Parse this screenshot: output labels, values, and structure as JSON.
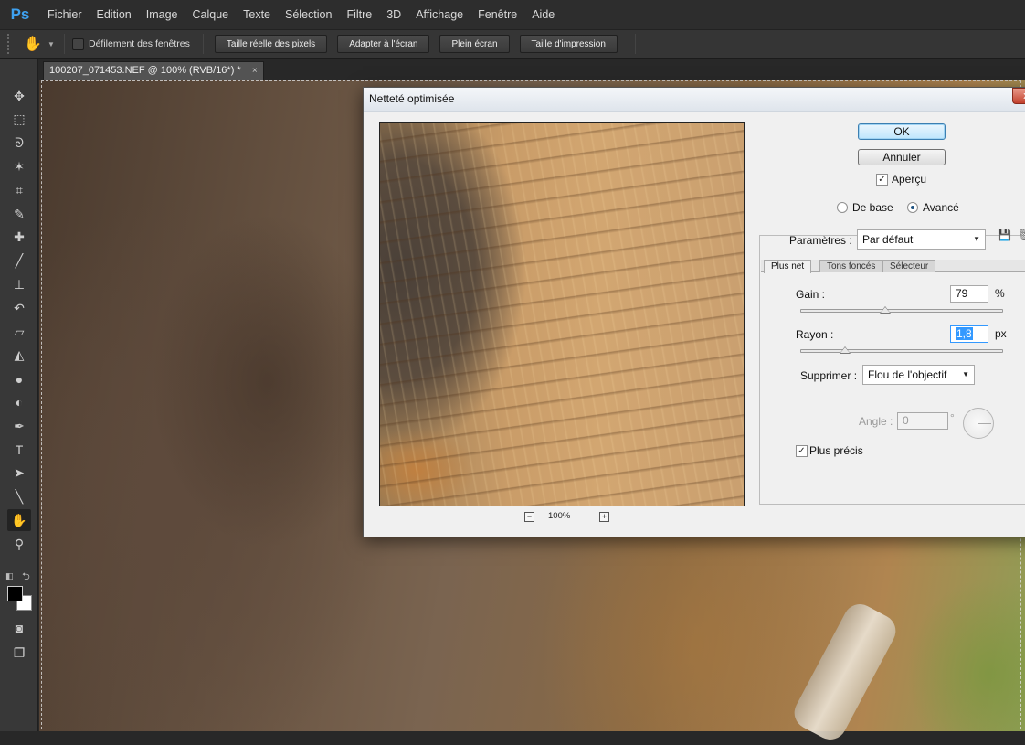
{
  "app": {
    "logo": "Ps",
    "menus": [
      "Fichier",
      "Edition",
      "Image",
      "Calque",
      "Texte",
      "Sélection",
      "Filtre",
      "3D",
      "Affichage",
      "Fenêtre",
      "Aide"
    ]
  },
  "options_bar": {
    "tool_icon": "hand-icon",
    "scroll_all_label": "Défilement des fenêtres",
    "scroll_all_checked": false,
    "buttons": [
      "Taille réelle des pixels",
      "Adapter à l'écran",
      "Plein écran",
      "Taille d'impression"
    ]
  },
  "tools": [
    "move-icon",
    "marquee-icon",
    "lasso-icon",
    "magic-wand-icon",
    "crop-icon",
    "eyedropper-icon",
    "healing-brush-icon",
    "brush-icon",
    "clone-stamp-icon",
    "history-brush-icon",
    "eraser-icon",
    "paint-bucket-icon",
    "blur-icon",
    "dodge-icon",
    "pen-icon",
    "type-icon",
    "path-selection-icon",
    "line-icon",
    "hand-icon",
    "zoom-icon"
  ],
  "colors": {
    "foreground": "#000000",
    "background": "#ffffff",
    "accent": "#3ea1f0"
  },
  "document": {
    "tab_title": "100207_071453.NEF @ 100% (RVB/16*) *",
    "close": "×"
  },
  "dialog": {
    "title": "Netteté optimisée",
    "close_glyph": "x",
    "ok_label": "OK",
    "cancel_label": "Annuler",
    "preview_label": "Aperçu",
    "preview_checked": true,
    "mode_basic_label": "De base",
    "mode_advanced_label": "Avancé",
    "mode_selected": "Avancé",
    "zoom": {
      "minus": "−",
      "level": "100%",
      "plus": "+"
    },
    "settings": {
      "label": "Paramètres :",
      "value": "Par défaut",
      "tabs": [
        "Plus net",
        "Tons foncés",
        "Sélecteur"
      ],
      "active_tab": "Plus net",
      "amount": {
        "label": "Gain :",
        "value": "79",
        "unit": "%",
        "slider_fraction": 0.42
      },
      "radius": {
        "label": "Rayon :",
        "value": "1,8",
        "unit": "px",
        "slider_fraction": 0.22
      },
      "remove": {
        "label": "Supprimer :",
        "value": "Flou de l'objectif"
      },
      "angle": {
        "label": "Angle :",
        "value": "0",
        "unit": "°"
      },
      "more_accurate": {
        "label": "Plus précis",
        "checked": true
      }
    }
  }
}
